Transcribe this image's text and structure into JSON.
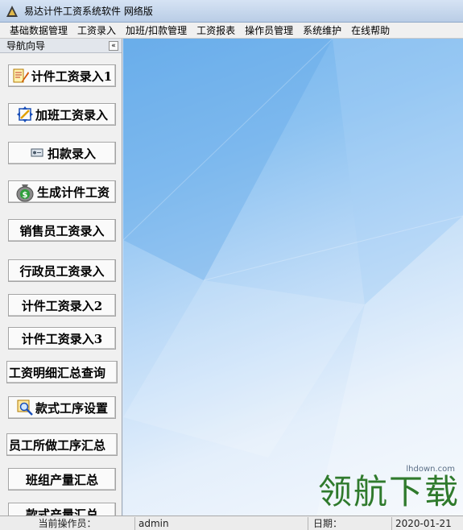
{
  "window": {
    "title": "易达计件工资系统软件  网络版"
  },
  "menu": [
    "基础数据管理",
    "工资录入",
    "加班/扣款管理",
    "工资报表",
    "操作员管理",
    "系统维护",
    "在线帮助"
  ],
  "sidebar": {
    "title": "导航向导",
    "collapse_glyph": "«",
    "buttons": [
      {
        "label": "计件工资录入1",
        "icon": "edit-form-icon"
      },
      {
        "label": "加班工资录入",
        "icon": "pencil-resize-icon"
      },
      {
        "label": "扣款录入",
        "icon": "deduct-icon"
      },
      {
        "label": "生成计件工资",
        "icon": "money-bag-icon"
      },
      {
        "label": "销售员工资录入"
      },
      {
        "label": "行政员工资录入"
      },
      {
        "label": "计件工资录入2"
      },
      {
        "label": "计件工资录入3"
      },
      {
        "label": "工资明细汇总查询"
      },
      {
        "label": "款式工序设置",
        "icon": "search-tools-icon"
      },
      {
        "label": "员工所做工序汇总"
      },
      {
        "label": "班组产量汇总"
      },
      {
        "label": "款式产量汇总"
      }
    ]
  },
  "statusbar": {
    "operator_label": "当前操作员：",
    "operator_value": "admin",
    "date_label": "日期：",
    "date_value": "2020-01-21"
  },
  "watermark": {
    "url": "lhdown.com",
    "text": "领航下载"
  }
}
